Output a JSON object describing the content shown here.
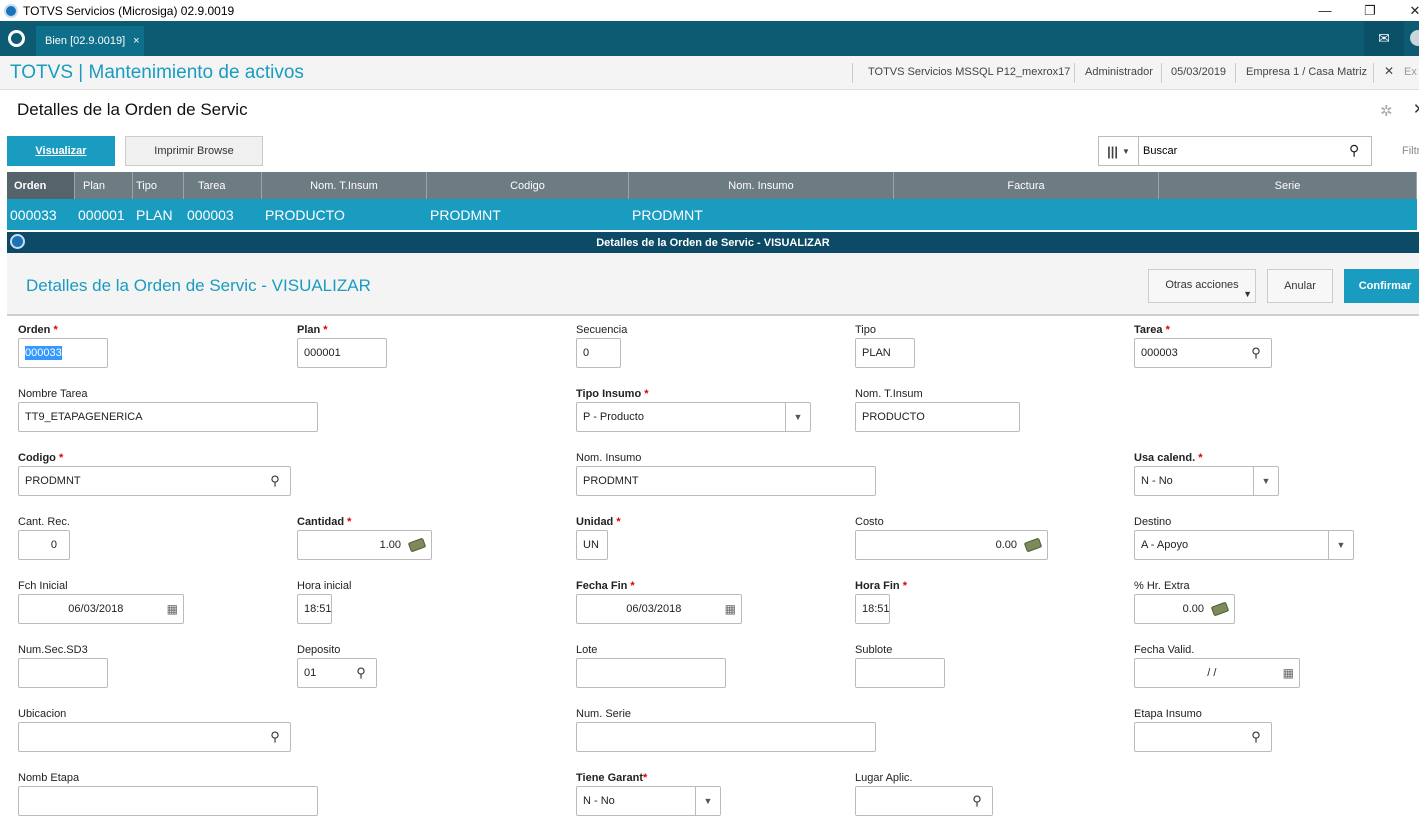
{
  "window": {
    "title": "TOTVS Servicios (Microsiga) 02.9.0019"
  },
  "tabs": {
    "active_tab": "Bien [02.9.0019]",
    "close_glyph": "×"
  },
  "header": {
    "app_title": "TOTVS | Mantenimiento de activos",
    "environment": "TOTVS Servicios MSSQL P12_mexrox17",
    "user": "Administrador",
    "date": "05/03/2019",
    "company": "Empresa 1 / Casa Matriz",
    "exit_label": "Ex"
  },
  "page": {
    "title": "Detalles de la Orden de Servic"
  },
  "toolbar": {
    "visualizar": "Visualizar",
    "imprimir": "Imprimir Browse",
    "search_value": "Buscar",
    "filter_label": "Filtr"
  },
  "grid": {
    "columns": [
      "Orden",
      "Plan",
      "Tipo",
      "Tarea",
      "Nom. T.Insum",
      "Codigo",
      "Nom. Insumo",
      "Factura",
      "Serie"
    ],
    "row": [
      "000033",
      "000001",
      "PLAN",
      "000003",
      "PRODUCTO",
      "PRODMNT",
      "PRODMNT",
      "",
      ""
    ]
  },
  "dialog": {
    "bar_title": "Detalles de la Orden de Servic - VISUALIZAR",
    "title": "Detalles de la Orden de Servic - VISUALIZAR",
    "otras_acciones": "Otras acciones",
    "anular": "Anular",
    "confirmar": "Confirmar"
  },
  "form": {
    "orden": {
      "label": "Orden",
      "value": "000033"
    },
    "plan": {
      "label": "Plan",
      "value": "000001"
    },
    "secuencia": {
      "label": "Secuencia",
      "value": "0"
    },
    "tipo": {
      "label": "Tipo",
      "value": "PLAN"
    },
    "tarea": {
      "label": "Tarea",
      "value": "000003"
    },
    "nombre_tarea": {
      "label": "Nombre Tarea",
      "value": "TT9_ETAPAGENERICA"
    },
    "tipo_insumo": {
      "label": "Tipo Insumo",
      "value": "P - Producto"
    },
    "nom_tinsum": {
      "label": "Nom. T.Insum",
      "value": "PRODUCTO"
    },
    "codigo": {
      "label": "Codigo",
      "value": "PRODMNT"
    },
    "nom_insumo": {
      "label": "Nom. Insumo",
      "value": "PRODMNT"
    },
    "usa_calend": {
      "label": "Usa calend.",
      "value": "N - No"
    },
    "cant_rec": {
      "label": "Cant. Rec.",
      "value": "0"
    },
    "cantidad": {
      "label": "Cantidad",
      "value": "1.00"
    },
    "unidad": {
      "label": "Unidad",
      "value": "UN"
    },
    "costo": {
      "label": "Costo",
      "value": "0.00"
    },
    "destino": {
      "label": "Destino",
      "value": "A - Apoyo"
    },
    "fch_inicial": {
      "label": "Fch Inicial",
      "value": "06/03/2018"
    },
    "hora_inicial": {
      "label": "Hora inicial",
      "value": "18:51"
    },
    "fecha_fin": {
      "label": "Fecha Fin",
      "value": "06/03/2018"
    },
    "hora_fin": {
      "label": "Hora Fin",
      "value": "18:51"
    },
    "hr_extra": {
      "label": "% Hr. Extra",
      "value": "0.00"
    },
    "num_sec_sd3": {
      "label": "Num.Sec.SD3",
      "value": ""
    },
    "deposito": {
      "label": "Deposito",
      "value": "01"
    },
    "lote": {
      "label": "Lote",
      "value": ""
    },
    "sublote": {
      "label": "Sublote",
      "value": ""
    },
    "fecha_valid": {
      "label": "Fecha Valid.",
      "value": "/ /"
    },
    "ubicacion": {
      "label": "Ubicacion",
      "value": ""
    },
    "num_serie": {
      "label": "Num. Serie",
      "value": ""
    },
    "etapa_insumo": {
      "label": "Etapa Insumo",
      "value": ""
    },
    "nomb_etapa": {
      "label": "Nomb Etapa",
      "value": ""
    },
    "tiene_garant": {
      "label": "Tiene Garant",
      "value": "N - No"
    },
    "lugar_aplic": {
      "label": "Lugar Aplic.",
      "value": ""
    }
  },
  "required_mark": "*",
  "colors": {
    "accent": "#1a9cc0",
    "tabbar": "#0c5b73",
    "dialog_bar": "#0c4a66",
    "grid_header": "#6d7b83",
    "required": "#dd0000"
  }
}
